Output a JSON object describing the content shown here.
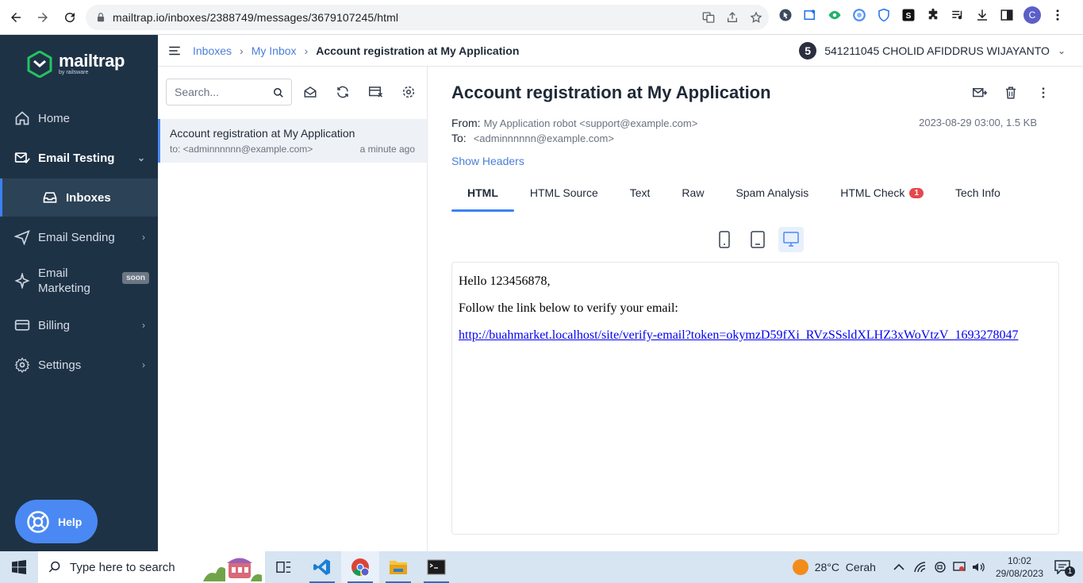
{
  "browser": {
    "url": "mailtrap.io/inboxes/2388749/messages/3679107245/html",
    "profile_initial": "C"
  },
  "sidebar": {
    "brand": "mailtrap",
    "brand_sub": "by railsware",
    "items": [
      {
        "label": "Home",
        "icon": "home-icon"
      },
      {
        "label": "Email Testing",
        "icon": "email-testing-icon"
      },
      {
        "label": "Inboxes",
        "icon": "inbox-icon"
      },
      {
        "label": "Email Sending",
        "icon": "paper-plane-icon"
      },
      {
        "label": "Email\nMarketing",
        "label_line1": "Email",
        "label_line2": "Marketing",
        "icon": "sparkle-icon",
        "badge": "soon"
      },
      {
        "label": "Billing",
        "icon": "billing-icon"
      },
      {
        "label": "Settings",
        "icon": "gear-icon"
      }
    ],
    "help_label": "Help"
  },
  "topbar": {
    "breadcrumb": [
      "Inboxes",
      "My Inbox",
      "Account registration at My Application"
    ],
    "user_badge": "5",
    "user_name": "541211045 CHOLID AFIDDRUS WIJAYANTO"
  },
  "message_list": {
    "search_placeholder": "Search...",
    "messages": [
      {
        "subject": "Account registration at My Application",
        "to": "to: <adminnnnnn@example.com>",
        "time": "a minute ago"
      }
    ]
  },
  "message": {
    "subject": "Account registration at My Application",
    "from_label": "From:",
    "from_value": "My Application robot <support@example.com>",
    "to_label": "To:",
    "to_value": "<adminnnnnn@example.com>",
    "meta": "2023-08-29 03:00, 1.5 KB",
    "show_headers": "Show Headers",
    "tabs": [
      {
        "label": "HTML",
        "active": true
      },
      {
        "label": "HTML Source"
      },
      {
        "label": "Text"
      },
      {
        "label": "Raw"
      },
      {
        "label": "Spam Analysis"
      },
      {
        "label": "HTML Check",
        "badge": "1"
      },
      {
        "label": "Tech Info"
      }
    ],
    "body": {
      "greeting": "Hello 123456878,",
      "instruction": "Follow the link below to verify your email:",
      "link": "http://buahmarket.localhost/site/verify-email?token=okymzD59fXi_RVzSSsldXLHZ3xWoVtzV_1693278047"
    }
  },
  "taskbar": {
    "search_placeholder": "Type here to search",
    "weather": "28°C  Cerah",
    "time": "10:02",
    "date": "29/08/2023",
    "notification_count": "1"
  },
  "colors": {
    "sidebar_bg": "#1e3246",
    "accent": "#3b82f6",
    "link": "#4a7fd8",
    "badge_red": "#e5484d"
  }
}
